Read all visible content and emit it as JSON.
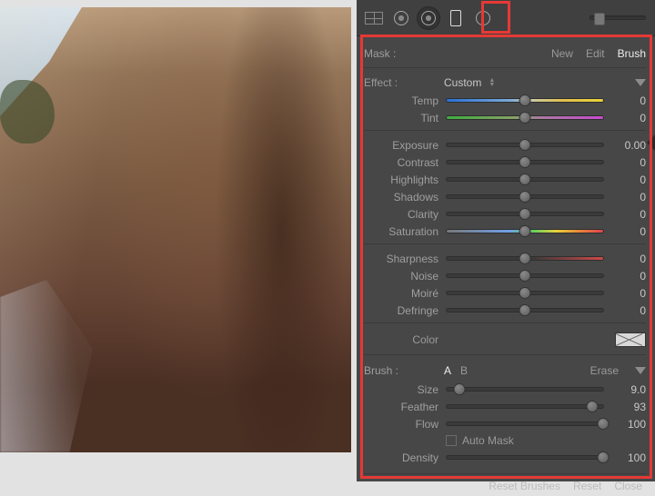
{
  "toolbar": {
    "crop_tool": "crop-grid",
    "spot_tool": "spot-circle",
    "redeye_tool": "redeye-circle",
    "gradient_tool": "gradient-rect",
    "radial_tool": "radial-circle"
  },
  "mask": {
    "label": "Mask :",
    "new": "New",
    "edit": "Edit",
    "brush": "Brush",
    "active": "brush"
  },
  "effect": {
    "label": "Effect :",
    "preset": "Custom",
    "sliders": [
      {
        "name": "Temp",
        "value": "0",
        "pos": 50,
        "style": "temp"
      },
      {
        "name": "Tint",
        "value": "0",
        "pos": 50,
        "style": "tint"
      }
    ],
    "sliders2": [
      {
        "name": "Exposure",
        "value": "0.00",
        "pos": 50,
        "style": "plain"
      },
      {
        "name": "Contrast",
        "value": "0",
        "pos": 50,
        "style": "plain"
      },
      {
        "name": "Highlights",
        "value": "0",
        "pos": 50,
        "style": "plain"
      },
      {
        "name": "Shadows",
        "value": "0",
        "pos": 50,
        "style": "plain"
      },
      {
        "name": "Clarity",
        "value": "0",
        "pos": 50,
        "style": "plain"
      },
      {
        "name": "Saturation",
        "value": "0",
        "pos": 50,
        "style": "sat"
      }
    ],
    "sliders3": [
      {
        "name": "Sharpness",
        "value": "0",
        "pos": 50,
        "style": "sharp"
      },
      {
        "name": "Noise",
        "value": "0",
        "pos": 50,
        "style": "plain"
      },
      {
        "name": "Moiré",
        "value": "0",
        "pos": 50,
        "style": "plain"
      },
      {
        "name": "Defringe",
        "value": "0",
        "pos": 50,
        "style": "plain"
      }
    ],
    "color_label": "Color"
  },
  "brush": {
    "label": "Brush :",
    "a": "A",
    "b": "B",
    "erase": "Erase",
    "active": "a",
    "sliders": [
      {
        "name": "Size",
        "value": "9.0",
        "pos": 8
      },
      {
        "name": "Feather",
        "value": "93",
        "pos": 93
      },
      {
        "name": "Flow",
        "value": "100",
        "pos": 100
      }
    ],
    "automask_label": "Auto Mask",
    "density": {
      "name": "Density",
      "value": "100",
      "pos": 100
    }
  },
  "footer": {
    "reset_brushes": "Reset Brushes",
    "reset": "Reset",
    "close": "Close"
  }
}
